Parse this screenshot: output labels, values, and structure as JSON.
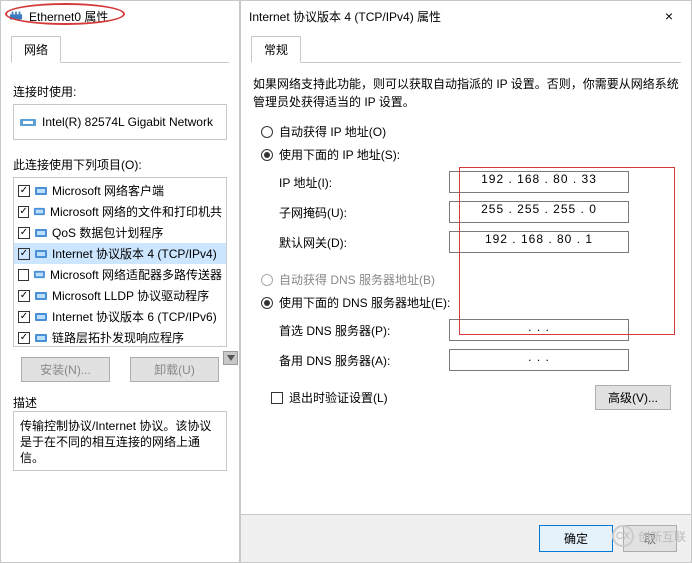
{
  "left": {
    "title": "Ethernet0 属性",
    "tab_network": "网络",
    "connect_using": "连接时使用:",
    "adapter": "Intel(R) 82574L Gigabit Network",
    "items_label": "此连接使用下列项目(O):",
    "items": [
      {
        "checked": true,
        "icon": "client",
        "label": "Microsoft 网络客户端"
      },
      {
        "checked": true,
        "icon": "share",
        "label": "Microsoft 网络的文件和打印机共"
      },
      {
        "checked": true,
        "icon": "qos",
        "label": "QoS 数据包计划程序"
      },
      {
        "checked": true,
        "icon": "proto",
        "label": "Internet 协议版本 4 (TCP/IPv4)"
      },
      {
        "checked": false,
        "icon": "proto",
        "label": "Microsoft 网络适配器多路传送器"
      },
      {
        "checked": true,
        "icon": "proto",
        "label": "Microsoft LLDP 协议驱动程序"
      },
      {
        "checked": true,
        "icon": "proto",
        "label": "Internet 协议版本 6 (TCP/IPv6)"
      },
      {
        "checked": true,
        "icon": "proto",
        "label": "链路层拓扑发现响应程序"
      }
    ],
    "install_btn": "安装(N)...",
    "uninstall_btn": "卸载(U)",
    "desc_label": "描述",
    "desc_text": "传输控制协议/Internet 协议。该协议是于在不同的相互连接的网络上通信。"
  },
  "right": {
    "title": "Internet 协议版本 4 (TCP/IPv4) 属性",
    "tab_general": "常规",
    "desc": "如果网络支持此功能，则可以获取自动指派的 IP 设置。否则，你需要从网络系统管理员处获得适当的 IP 设置。",
    "auto_ip": "自动获得 IP 地址(O)",
    "use_ip": "使用下面的 IP 地址(S):",
    "ip_label": "IP 地址(I):",
    "ip_value": "192 . 168 .  80  .  33",
    "mask_label": "子网掩码(U):",
    "mask_value": "255 . 255 . 255 .   0",
    "gw_label": "默认网关(D):",
    "gw_value": "192 . 168 .  80  .   1",
    "auto_dns": "自动获得 DNS 服务器地址(B)",
    "use_dns": "使用下面的 DNS 服务器地址(E):",
    "dns1_label": "首选 DNS 服务器(P):",
    "dns1_value": "   .       .       .   ",
    "dns2_label": "备用 DNS 服务器(A):",
    "dns2_value": "   .       .       .   ",
    "validate": "退出时验证设置(L)",
    "advanced": "高级(V)...",
    "ok": "确定",
    "cancel": "取"
  },
  "watermark": "创新互联"
}
